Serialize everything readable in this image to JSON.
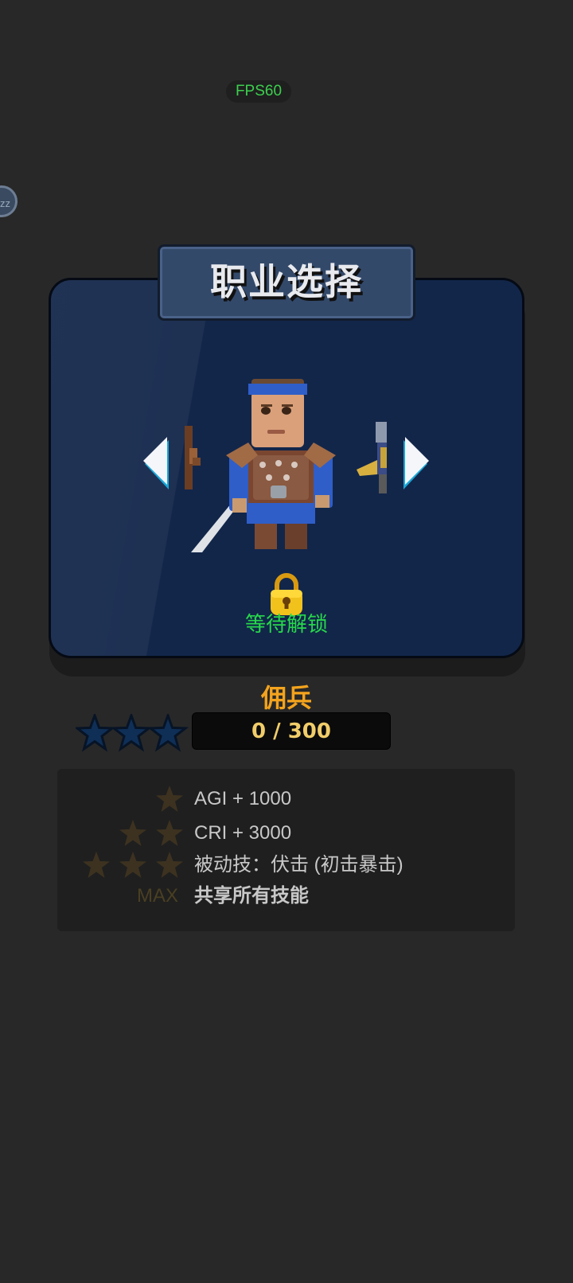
{
  "hud": {
    "fps": "FPS60",
    "side_button": "zz"
  },
  "title": "职业选择",
  "character": {
    "lock_status": "等待解锁",
    "name": "佣兵",
    "progress": "0 / 300",
    "stars_earned": 0,
    "stars_total": 3
  },
  "bonuses": [
    {
      "tier_stars": 1,
      "text": "AGI + 1000",
      "bold": false
    },
    {
      "tier_stars": 2,
      "text": "CRI + 3000",
      "bold": false
    },
    {
      "tier_stars": 3,
      "text": "被动技：伏击 (初击暴击)",
      "bold": false
    },
    {
      "tier_label": "MAX",
      "text": "共享所有技能",
      "bold": true
    }
  ],
  "colors": {
    "background": "#282828",
    "panel": "#12264a",
    "title_plate": "#33496a",
    "lock_text": "#27d84a",
    "name_text": "#f3a31d",
    "progress_text": "#f1cd6a",
    "fps_text": "#3ccf4e",
    "star_empty": "#0f2f57",
    "tier_star": "#3d3220"
  },
  "icons": {
    "prev": "arrow-left-icon",
    "next": "arrow-right-icon",
    "lock": "padlock-icon",
    "star": "star-icon"
  }
}
